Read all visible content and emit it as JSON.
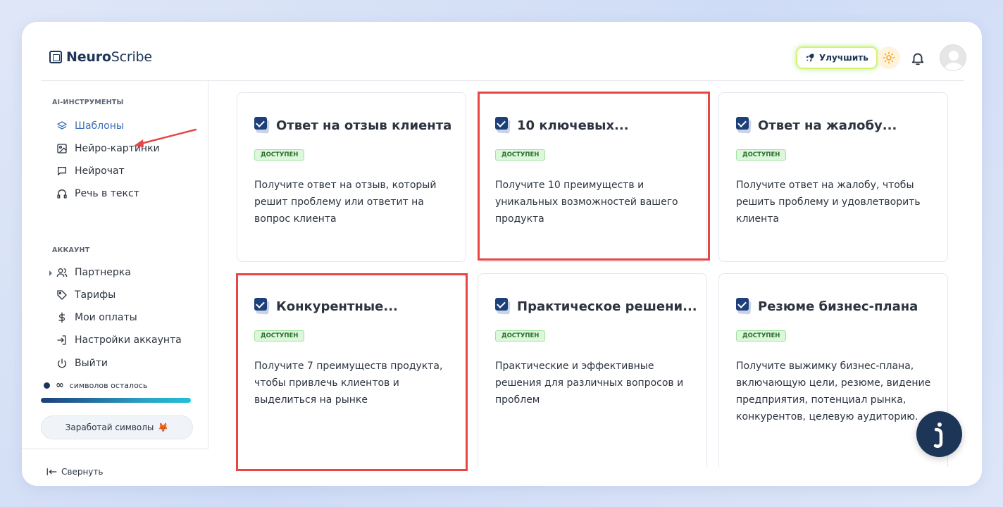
{
  "header": {
    "logo_bold": "Neuro",
    "logo_regular": "Scribe",
    "upgrade_label": "Улучшить"
  },
  "sidebar": {
    "section_tools": "AI-ИНСТРУМЕНТЫ",
    "tools": [
      {
        "label": "Шаблоны",
        "icon": "layers-icon",
        "active": true
      },
      {
        "label": "Нейро-картинки",
        "icon": "image-icon"
      },
      {
        "label": "Нейрочат",
        "icon": "chat-icon"
      },
      {
        "label": "Речь в текст",
        "icon": "headphones-icon"
      }
    ],
    "section_account": "АККАУНТ",
    "account": [
      {
        "label": "Партнерка",
        "icon": "users-icon"
      },
      {
        "label": "Тарифы",
        "icon": "tag-icon"
      },
      {
        "label": "Мои оплаты",
        "icon": "dollar-icon"
      },
      {
        "label": "Настройки аккаунта",
        "icon": "login-icon"
      },
      {
        "label": "Выйти",
        "icon": "power-icon"
      }
    ],
    "credits_symbol": "∞",
    "credits_text": "символов осталось",
    "earn_label": "Заработай символы",
    "collapse_label": "Свернуть"
  },
  "cards": [
    {
      "title": "Ответ на отзыв клиента",
      "badge": "ДОСТУПЕН",
      "desc": "Получите ответ на отзыв, который решит проблему или ответит на вопрос клиента"
    },
    {
      "title": "10 ключевых...",
      "badge": "ДОСТУПЕН",
      "desc": "Получите 10 преимуществ и уникальных возможностей вашего продукта"
    },
    {
      "title": "Ответ на жалобу...",
      "badge": "ДОСТУПЕН",
      "desc": "Получите ответ на жалобу, чтобы решить проблему и удовлетворить клиента"
    },
    {
      "title": "Конкурентные...",
      "badge": "ДОСТУПЕН",
      "desc": "Получите 7 преимуществ продукта, чтобы привлечь клиентов и выделиться на рынке"
    },
    {
      "title": "Практическое решени...",
      "badge": "ДОСТУПЕН",
      "desc": "Практические и эффективные решения для различных вопросов и проблем"
    },
    {
      "title": "Резюме бизнес-плана",
      "badge": "ДОСТУПЕН",
      "desc": "Получите выжимку бизнес-плана, включающую цели, резюме, видение предприятия, потенциал рынка, конкурентов, целевую аудиторию."
    }
  ],
  "colors": {
    "brand": "#1d3557",
    "active_nav": "#3b6fb6",
    "badge_bg": "#dcf7dc",
    "annotation": "#e84545"
  }
}
